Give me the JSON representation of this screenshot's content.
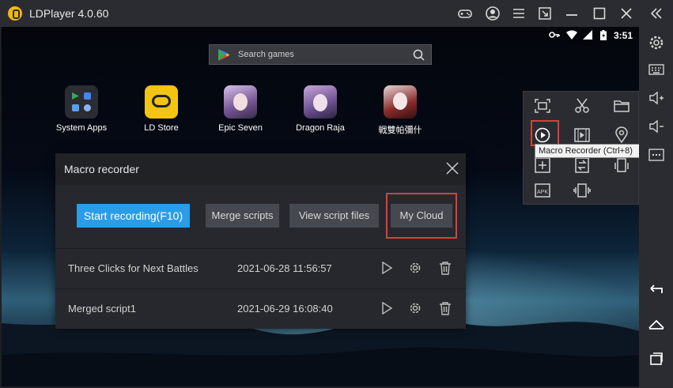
{
  "window": {
    "title": "LDPlayer 4.0.60",
    "toolbar_icons": [
      "gamepad-icon",
      "account-icon",
      "menu-icon",
      "resize-icon",
      "minimize-icon",
      "maximize-icon",
      "close-icon",
      "collapse-icon"
    ]
  },
  "status_bar": {
    "time": "3:51",
    "icons": [
      "key-icon",
      "wifi-icon",
      "signal-icon",
      "battery-icon"
    ]
  },
  "search": {
    "placeholder": "Search games"
  },
  "apps": [
    {
      "label": "System Apps",
      "icon": "system-apps-icon"
    },
    {
      "label": "LD Store",
      "icon": "ld-store-icon"
    },
    {
      "label": "Epic Seven",
      "icon": "epic-seven-icon"
    },
    {
      "label": "Dragon Raja",
      "icon": "dragon-raja-icon"
    },
    {
      "label": "戦雙帕彌什",
      "icon": "punishing-icon"
    }
  ],
  "macro_recorder": {
    "title": "Macro recorder",
    "buttons": {
      "start": "Start recording(F10)",
      "merge": "Merge scripts",
      "view": "View script files",
      "cloud": "My Cloud"
    },
    "scripts": [
      {
        "name": "Three Clicks for Next Battles",
        "time": "2021-06-28 11:56:57"
      },
      {
        "name": "Merged script1",
        "time": "2021-06-29 16:08:40"
      }
    ]
  },
  "tool_panel": {
    "icons": [
      "screenshot-icon",
      "scissors-icon",
      "folder-icon",
      "macro-recorder-icon",
      "video-icon",
      "location-icon",
      "add-icon",
      "sync-icon",
      "rotate-icon",
      "apk-icon",
      "shake-icon"
    ],
    "tooltip": "Macro Recorder (Ctrl+8)"
  },
  "sidebar": {
    "icons": [
      "settings-icon",
      "keyboard-icon",
      "volume-up-icon",
      "volume-down-icon",
      "more-icon",
      "back-icon",
      "home-icon",
      "recents-icon"
    ]
  },
  "colors": {
    "accent": "#2a9de8",
    "highlight": "#e03c3c",
    "panel": "#26282d"
  }
}
